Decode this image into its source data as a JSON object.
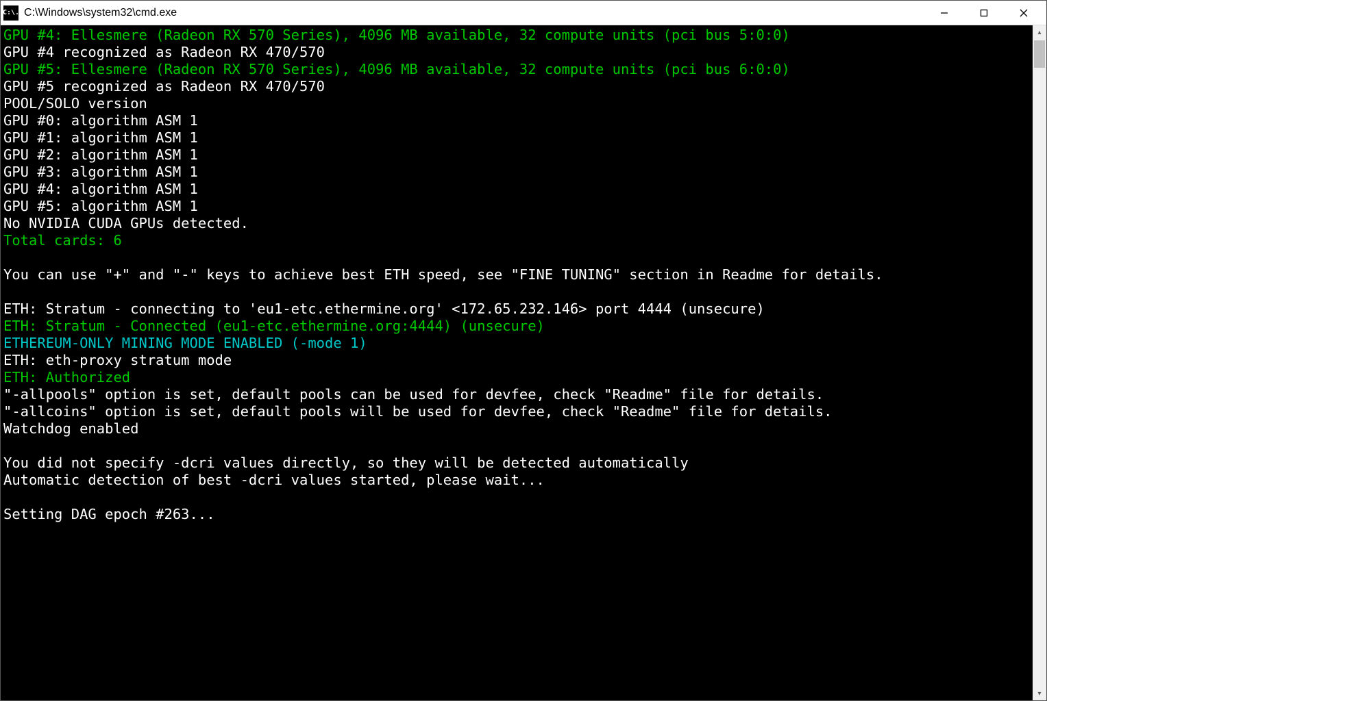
{
  "window": {
    "icon_text": "C:\\.",
    "title": "C:\\Windows\\system32\\cmd.exe"
  },
  "lines": [
    {
      "color": "green",
      "text": "GPU #4: Ellesmere (Radeon RX 570 Series), 4096 MB available, 32 compute units (pci bus 5:0:0)"
    },
    {
      "color": "white",
      "text": "GPU #4 recognized as Radeon RX 470/570"
    },
    {
      "color": "green",
      "text": "GPU #5: Ellesmere (Radeon RX 570 Series), 4096 MB available, 32 compute units (pci bus 6:0:0)"
    },
    {
      "color": "white",
      "text": "GPU #5 recognized as Radeon RX 470/570"
    },
    {
      "color": "white",
      "text": "POOL/SOLO version"
    },
    {
      "color": "white",
      "text": "GPU #0: algorithm ASM 1"
    },
    {
      "color": "white",
      "text": "GPU #1: algorithm ASM 1"
    },
    {
      "color": "white",
      "text": "GPU #2: algorithm ASM 1"
    },
    {
      "color": "white",
      "text": "GPU #3: algorithm ASM 1"
    },
    {
      "color": "white",
      "text": "GPU #4: algorithm ASM 1"
    },
    {
      "color": "white",
      "text": "GPU #5: algorithm ASM 1"
    },
    {
      "color": "white",
      "text": "No NVIDIA CUDA GPUs detected."
    },
    {
      "color": "green",
      "text": "Total cards: 6"
    },
    {
      "color": "white",
      "text": ""
    },
    {
      "color": "white",
      "text": "You can use \"+\" and \"-\" keys to achieve best ETH speed, see \"FINE TUNING\" section in Readme for details."
    },
    {
      "color": "white",
      "text": ""
    },
    {
      "color": "white",
      "text": "ETH: Stratum - connecting to 'eu1-etc.ethermine.org' <172.65.232.146> port 4444 (unsecure)"
    },
    {
      "color": "green",
      "text": "ETH: Stratum - Connected (eu1-etc.ethermine.org:4444) (unsecure)"
    },
    {
      "color": "teal",
      "text": "ETHEREUM-ONLY MINING MODE ENABLED (-mode 1)"
    },
    {
      "color": "white",
      "text": "ETH: eth-proxy stratum mode"
    },
    {
      "color": "green",
      "text": "ETH: Authorized"
    },
    {
      "color": "white",
      "text": "\"-allpools\" option is set, default pools can be used for devfee, check \"Readme\" file for details."
    },
    {
      "color": "white",
      "text": "\"-allcoins\" option is set, default pools will be used for devfee, check \"Readme\" file for details."
    },
    {
      "color": "white",
      "text": "Watchdog enabled"
    },
    {
      "color": "white",
      "text": ""
    },
    {
      "color": "white",
      "text": "You did not specify -dcri values directly, so they will be detected automatically"
    },
    {
      "color": "white",
      "text": "Automatic detection of best -dcri values started, please wait..."
    },
    {
      "color": "white",
      "text": ""
    },
    {
      "color": "white",
      "text": "Setting DAG epoch #263..."
    }
  ]
}
